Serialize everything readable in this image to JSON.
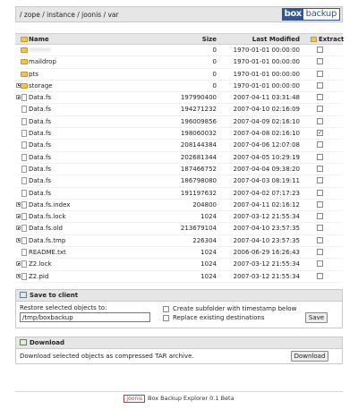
{
  "header": {
    "breadcrumb": "/ zope / instance / joonis / var",
    "logo_box": "box",
    "logo_backup": "backup"
  },
  "table": {
    "columns": {
      "name": "Name",
      "size": "Size",
      "modified": "Last Modified",
      "extract": "Extract"
    },
    "rows": [
      {
        "kind": "folder",
        "expandable": false,
        "name": "••••••",
        "size": "0",
        "modified": "1970-01-01 00:00:00",
        "checked": false,
        "blurred": true
      },
      {
        "kind": "folder",
        "expandable": false,
        "name": "maildrop",
        "size": "0",
        "modified": "1970-01-01 00:00:00",
        "checked": false
      },
      {
        "kind": "folder",
        "expandable": false,
        "name": "pts",
        "size": "0",
        "modified": "1970-01-01 00:00:00",
        "checked": false
      },
      {
        "kind": "folder",
        "expandable": true,
        "name": "storage",
        "size": "0",
        "modified": "1970-01-01 00:00:00",
        "checked": false
      },
      {
        "kind": "file",
        "expandable": true,
        "name": "Data.fs",
        "size": "197990400",
        "modified": "2007-04-11 03:31:48",
        "checked": false
      },
      {
        "kind": "file",
        "expandable": false,
        "name": "Data.fs",
        "size": "194271232",
        "modified": "2007-04-10 02:16:09",
        "checked": false
      },
      {
        "kind": "file",
        "expandable": false,
        "name": "Data.fs",
        "size": "196009856",
        "modified": "2007-04-09 02:16:10",
        "checked": false
      },
      {
        "kind": "file",
        "expandable": false,
        "name": "Data.fs",
        "size": "198060032",
        "modified": "2007-04-08 02:16:10",
        "checked": true
      },
      {
        "kind": "file",
        "expandable": false,
        "name": "Data.fs",
        "size": "208144384",
        "modified": "2007-04-06 12:07:08",
        "checked": false
      },
      {
        "kind": "file",
        "expandable": false,
        "name": "Data.fs",
        "size": "202681344",
        "modified": "2007-04-05 10:29:19",
        "checked": false
      },
      {
        "kind": "file",
        "expandable": false,
        "name": "Data.fs",
        "size": "187466752",
        "modified": "2007-04-04 09:38:20",
        "checked": false
      },
      {
        "kind": "file",
        "expandable": false,
        "name": "Data.fs",
        "size": "186798080",
        "modified": "2007-04-03 08:19:11",
        "checked": false
      },
      {
        "kind": "file",
        "expandable": false,
        "name": "Data.fs",
        "size": "191197632",
        "modified": "2007-04-02 07:17:23",
        "checked": false
      },
      {
        "kind": "file",
        "expandable": true,
        "name": "Data.fs.index",
        "size": "204800",
        "modified": "2007-04-11 02:16:12",
        "checked": false
      },
      {
        "kind": "file",
        "expandable": true,
        "name": "Data.fs.lock",
        "size": "1024",
        "modified": "2007-03-12 21:55:34",
        "checked": false
      },
      {
        "kind": "file",
        "expandable": true,
        "name": "Data.fs.old",
        "size": "213679104",
        "modified": "2007-04-10 23:57:35",
        "checked": false
      },
      {
        "kind": "file",
        "expandable": true,
        "name": "Data.fs.tmp",
        "size": "226304",
        "modified": "2007-04-10 23:57:35",
        "checked": false
      },
      {
        "kind": "file",
        "expandable": false,
        "name": "README.txt",
        "size": "1024",
        "modified": "2006-06-29 16:26:43",
        "checked": false
      },
      {
        "kind": "file",
        "expandable": true,
        "name": "Z2.lock",
        "size": "1024",
        "modified": "2007-03-12 21:55:34",
        "checked": false
      },
      {
        "kind": "file",
        "expandable": true,
        "name": "Z2.pid",
        "size": "1024",
        "modified": "2007-03-12 21:55:34",
        "checked": false
      }
    ]
  },
  "save_panel": {
    "title": "Save to client",
    "restore_label": "Restore selected objects to:",
    "restore_value": "/tmp/boxbackup",
    "opt_subfolder": "Create subfolder with timestamp below",
    "opt_replace": "Replace existing destinations",
    "save_button": "Save"
  },
  "download_panel": {
    "title": "Download",
    "description": "Download selected objects as compressed TAR archive.",
    "download_button": "Download"
  },
  "footer": {
    "badge": "joonis",
    "text": "Box Backup Explorer 0.1 Beta"
  },
  "colors": {
    "header_bg": "#e6e6e6",
    "logo_blue": "#35558f",
    "folder": "#f2c35a",
    "joonis_red": "#c0392b"
  }
}
